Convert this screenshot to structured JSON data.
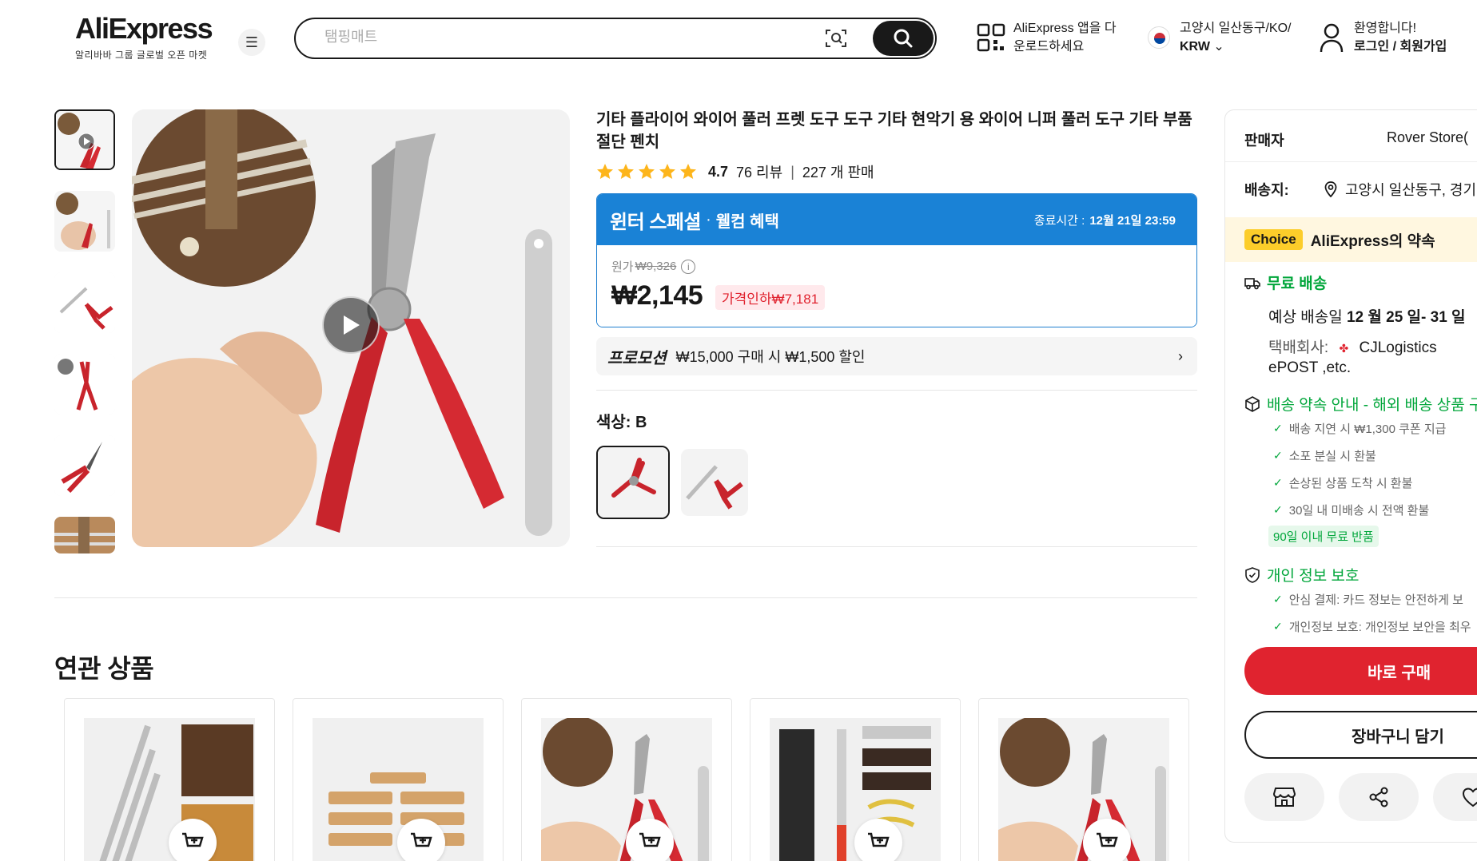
{
  "header": {
    "logo_text": "AliExpress",
    "logo_sub": "알리바바 그룹 글로벌 오픈 마켓",
    "search_placeholder": "탬핑매트",
    "app_line1": "AliExpress 앱을 다",
    "app_line2": "운로드하세요",
    "region_line1": "고양시 일산동구/KO/",
    "region_line2": "KRW",
    "account_line1": "환영합니다!",
    "account_line2": "로그인 / 회원가입"
  },
  "product": {
    "title": "기타 플라이어 와이어 풀러 프렛 도구 도구 기타 현악기 용 와이어 니퍼 풀러 도구 기타 부품 절단 펜치",
    "rating": "4.7",
    "reviews": "76 리뷰",
    "sold": "227 개 판매",
    "stars": 5
  },
  "deal": {
    "name": "윈터 스페셜",
    "dot": "·",
    "sub": "웰컴 혜택",
    "ends_label": "종료시간 :",
    "ends_value": "12월 21일 23:59",
    "orig_label": "원가",
    "orig_price": "₩9,326",
    "price": "₩2,145",
    "discount": "가격인하₩7,181"
  },
  "promo": {
    "label": "프로모션",
    "text": "₩15,000 구매 시 ₩1,500 할인"
  },
  "color": {
    "label": "색상: B"
  },
  "related": {
    "title": "연관 상품"
  },
  "panel": {
    "seller_label": "판매자",
    "seller_value": "Rover Store(",
    "ship_label": "배송지:",
    "ship_value": "고양시 일산동구, 경기",
    "choice_tag": "Choice",
    "choice_text": "AliExpress의 약속",
    "free_ship": "무료 배송",
    "delivery_prefix": "예상 배송일",
    "delivery_date": "12 월 25 일- 31 일",
    "carrier_label": "택배회사:",
    "carrier_name": "CJLogistics",
    "carrier_more": "ePOST ,etc.",
    "promise_head": "배송 약속 안내 - 해외 배송 상품 구",
    "promise_items": [
      "배송 지연 시 ₩1,300 쿠폰 지급",
      "소포 분실 시 환불",
      "손상된 상품 도착 시 환불",
      "30일 내 미배송 시 전액 환불"
    ],
    "return_tag": "90일 이내 무료 반품",
    "privacy_head": "개인 정보 보호",
    "privacy_items": [
      "안심 결제: 카드 정보는 안전하게 보",
      "개인정보 보호: 개인정보 보안을 최우"
    ],
    "buy_now": "바로 구매",
    "add_cart": "장바구니 담기"
  }
}
